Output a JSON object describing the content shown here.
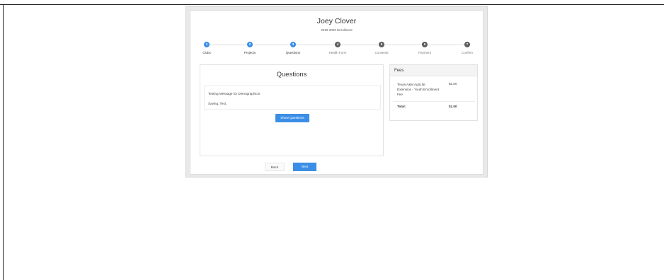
{
  "header": {
    "title": "Joey Clover",
    "subtitle": "2019-2020 Enrollment"
  },
  "steps": [
    {
      "number": "1",
      "label": "Clubs",
      "state": "done"
    },
    {
      "number": "2",
      "label": "Projects",
      "state": "done"
    },
    {
      "number": "3",
      "label": "Questions",
      "state": "current"
    },
    {
      "number": "4",
      "label": "Health Form",
      "state": "todo"
    },
    {
      "number": "5",
      "label": "Consents",
      "state": "todo"
    },
    {
      "number": "6",
      "label": "Payment",
      "state": "todo"
    },
    {
      "number": "7",
      "label": "Confirm",
      "state": "todo"
    }
  ],
  "questions": {
    "title": "Questions",
    "message_line1": "Testing Message for Demographics!",
    "message_line2": "Saving. Test.",
    "show_button": "Show Questions"
  },
  "fees": {
    "title": "Fees",
    "items": [
      {
        "description": "Texas A&M AgriLife Extension - Youth Enrollment Fee",
        "amount": "$1.00"
      }
    ],
    "total_label": "Total:",
    "total_amount": "$1.00"
  },
  "nav": {
    "back_label": "Back",
    "next_label": "Next"
  },
  "colors": {
    "accent": "#3b8ee6",
    "inactive_step": "#5d5d5d"
  }
}
